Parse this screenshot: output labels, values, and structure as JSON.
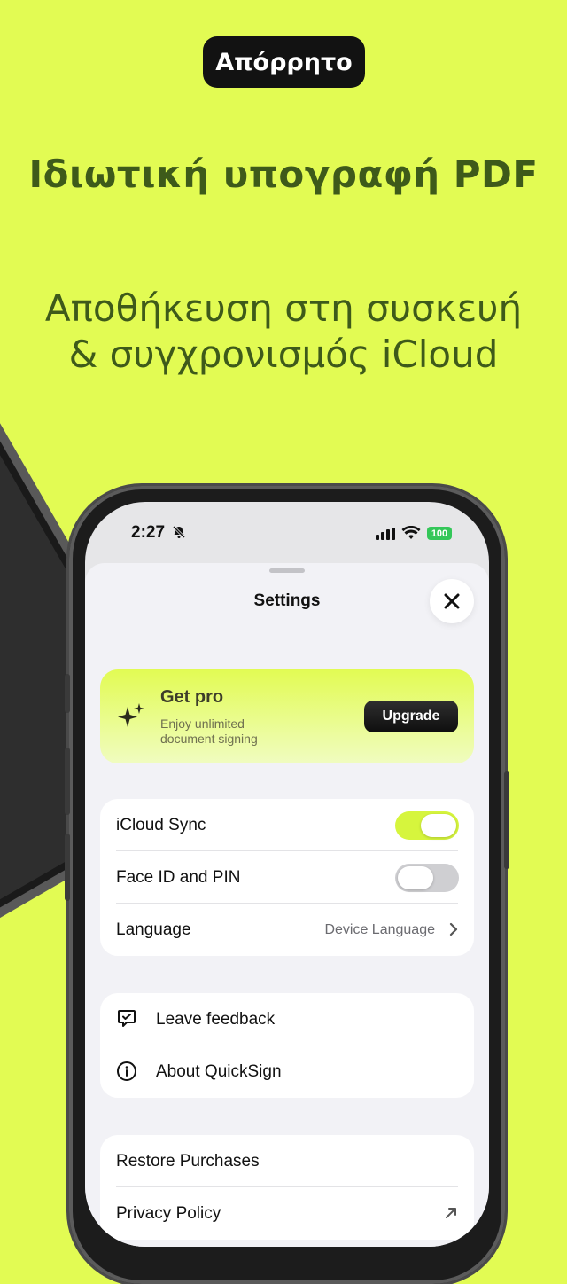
{
  "promo": {
    "badge": "Απόρρητο",
    "headline": "Ιδιωτική υπογραφή PDF",
    "subline_1": "Αποθήκευση στη συσκευή",
    "subline_2": "& συγχρονισμός iCloud"
  },
  "status_bar": {
    "time": "2:27",
    "battery": "100",
    "battery_color": "#34c759"
  },
  "settings": {
    "title": "Settings",
    "close_icon": "close-icon",
    "pro_card": {
      "title": "Get pro",
      "subtitle": "Enjoy unlimited document signing",
      "button": "Upgrade",
      "icon": "sparkle-icon",
      "accent": "#e2fb53"
    },
    "preferences": [
      {
        "label": "iCloud Sync",
        "toggle": true
      },
      {
        "label": "Face ID and PIN",
        "toggle": false
      },
      {
        "label": "Language",
        "value": "Device Language",
        "icon": "chevron-right-icon"
      }
    ],
    "support": [
      {
        "label": "Leave feedback",
        "icon": "feedback-icon"
      },
      {
        "label": "About QuickSign",
        "icon": "info-icon"
      }
    ],
    "legal": [
      {
        "label": "Restore Purchases"
      },
      {
        "label": "Privacy Policy",
        "icon": "external-link-icon"
      }
    ]
  }
}
